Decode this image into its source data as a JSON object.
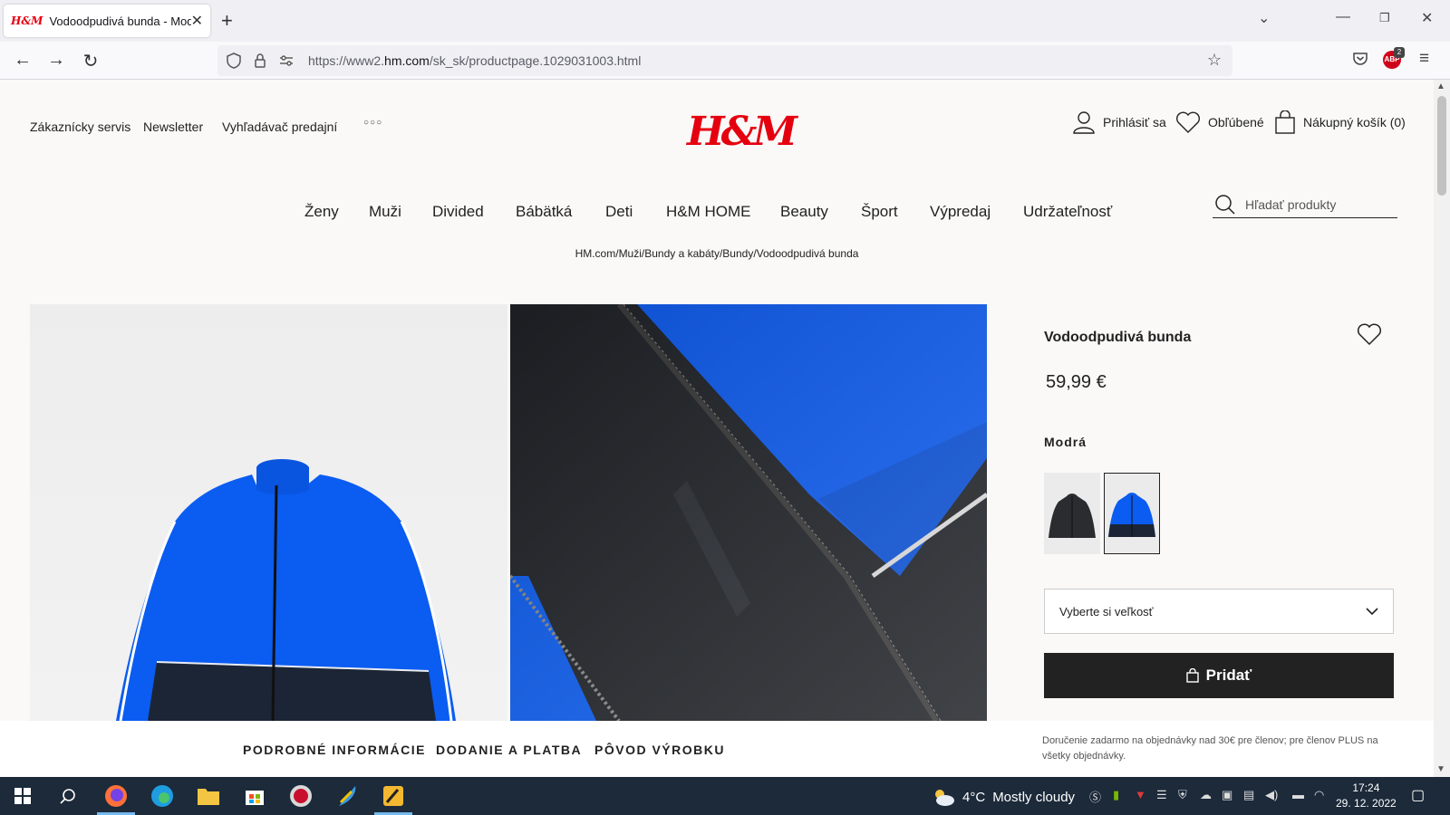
{
  "browser": {
    "tab_title": "Vodoodpudivá bunda - Modrá",
    "tab_favicon": "H&M",
    "url_prefix": "https://www2.",
    "url_domain": "hm.com",
    "url_path": "/sk_sk/productpage.1029031003.html",
    "abp_badge": "ABP",
    "abp_count": "2"
  },
  "header": {
    "utility_links": [
      "Zákaznícky servis",
      "Newsletter",
      "Vyhľadávač predajní"
    ],
    "logo": "H&M",
    "login": "Prihlásiť sa",
    "favorites": "Obľúbené",
    "cart": "Nákupný košík (0)"
  },
  "main_nav": [
    "Ženy",
    "Muži",
    "Divided",
    "Bábätká",
    "Deti",
    "H&M HOME",
    "Beauty",
    "Šport",
    "Výpredaj",
    "Udržateľnosť"
  ],
  "search": {
    "placeholder": "Hľadať produkty"
  },
  "breadcrumb": "HM.com/Muži/Bundy a kabáty/Bundy/Vodoodpudivá bunda",
  "product": {
    "title": "Vodoodpudivá bunda",
    "price": "59,99 €",
    "color": "Modrá",
    "size_select": "Vyberte si veľkosť",
    "add_button": "Pridať"
  },
  "bottom_tabs": [
    "PODROBNÉ INFORMÁCIE",
    "DODANIE A PLATBA",
    "PÔVOD VÝROBKU"
  ],
  "delivery_note": "Doručenie zadarmo na objednávky nad 30€ pre členov; pre členov PLUS na všetky objednávky.",
  "taskbar": {
    "weather_temp": "4°C",
    "weather_text": "Mostly cloudy",
    "time": "17:24",
    "date": "29. 12. 2022"
  },
  "colors": {
    "brand_red": "#e50010",
    "jacket_blue": "#0b5cf0",
    "jacket_navy": "#1b2535",
    "button_dark": "#222222"
  }
}
